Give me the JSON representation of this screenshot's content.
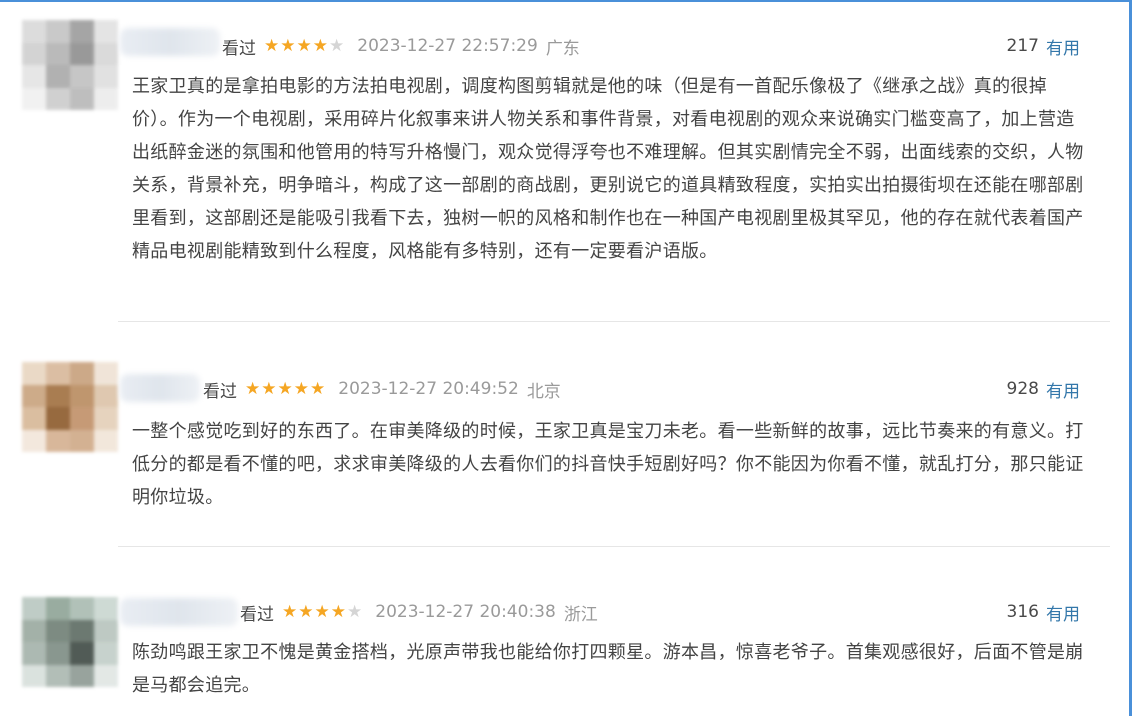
{
  "colors": {
    "star_on": "#f5a623",
    "star_off": "#d5d5d5",
    "useful_link": "#3377aa",
    "frame": "#4a90d9"
  },
  "icons": {
    "star": "★"
  },
  "reviews": [
    {
      "status": "看过",
      "rating": 4,
      "time": "2023-12-27 22:57:29",
      "location": "广东",
      "useful_count": "217",
      "useful_label": "有用",
      "content": "王家卫真的是拿拍电影的方法拍电视剧，调度构图剪辑就是他的味（但是有一首配乐像极了《继承之战》真的很掉价）。作为一个电视剧，采用碎片化叙事来讲人物关系和事件背景，对看电视剧的观众来说确实门槛变高了，加上营造出纸醉金迷的氛围和他管用的特写升格慢门，观众觉得浮夸也不难理解。但其实剧情完全不弱，出面线索的交织，人物关系，背景补充，明争暗斗，构成了这一部剧的商战剧，更别说它的道具精致程度，实拍实出拍摄街坝在还能在哪部剧里看到，这部剧还是能吸引我看下去，独树一帜的风格和制作也在一种国产电视剧里极其罕见，他的存在就代表着国产精品电视剧能精致到什么程度，风格能有多特别，还有一定要看沪语版。"
    },
    {
      "status": "看过",
      "rating": 5,
      "time": "2023-12-27 20:49:52",
      "location": "北京",
      "useful_count": "928",
      "useful_label": "有用",
      "content": "一整个感觉吃到好的东西了。在审美降级的时候，王家卫真是宝刀未老。看一些新鲜的故事，远比节奏来的有意义。打低分的都是看不懂的吧，求求审美降级的人去看你们的抖音快手短剧好吗？你不能因为你看不懂，就乱打分，那只能证明你垃圾。"
    },
    {
      "status": "看过",
      "rating": 4,
      "time": "2023-12-27 20:40:38",
      "location": "浙江",
      "useful_count": "316",
      "useful_label": "有用",
      "content": "陈劲鸣跟王家卫不愧是黄金搭档，光原声带我也能给你打四颗星。游本昌，惊喜老爷子。首集观感很好，后面不管是崩是马都会追完。"
    }
  ]
}
